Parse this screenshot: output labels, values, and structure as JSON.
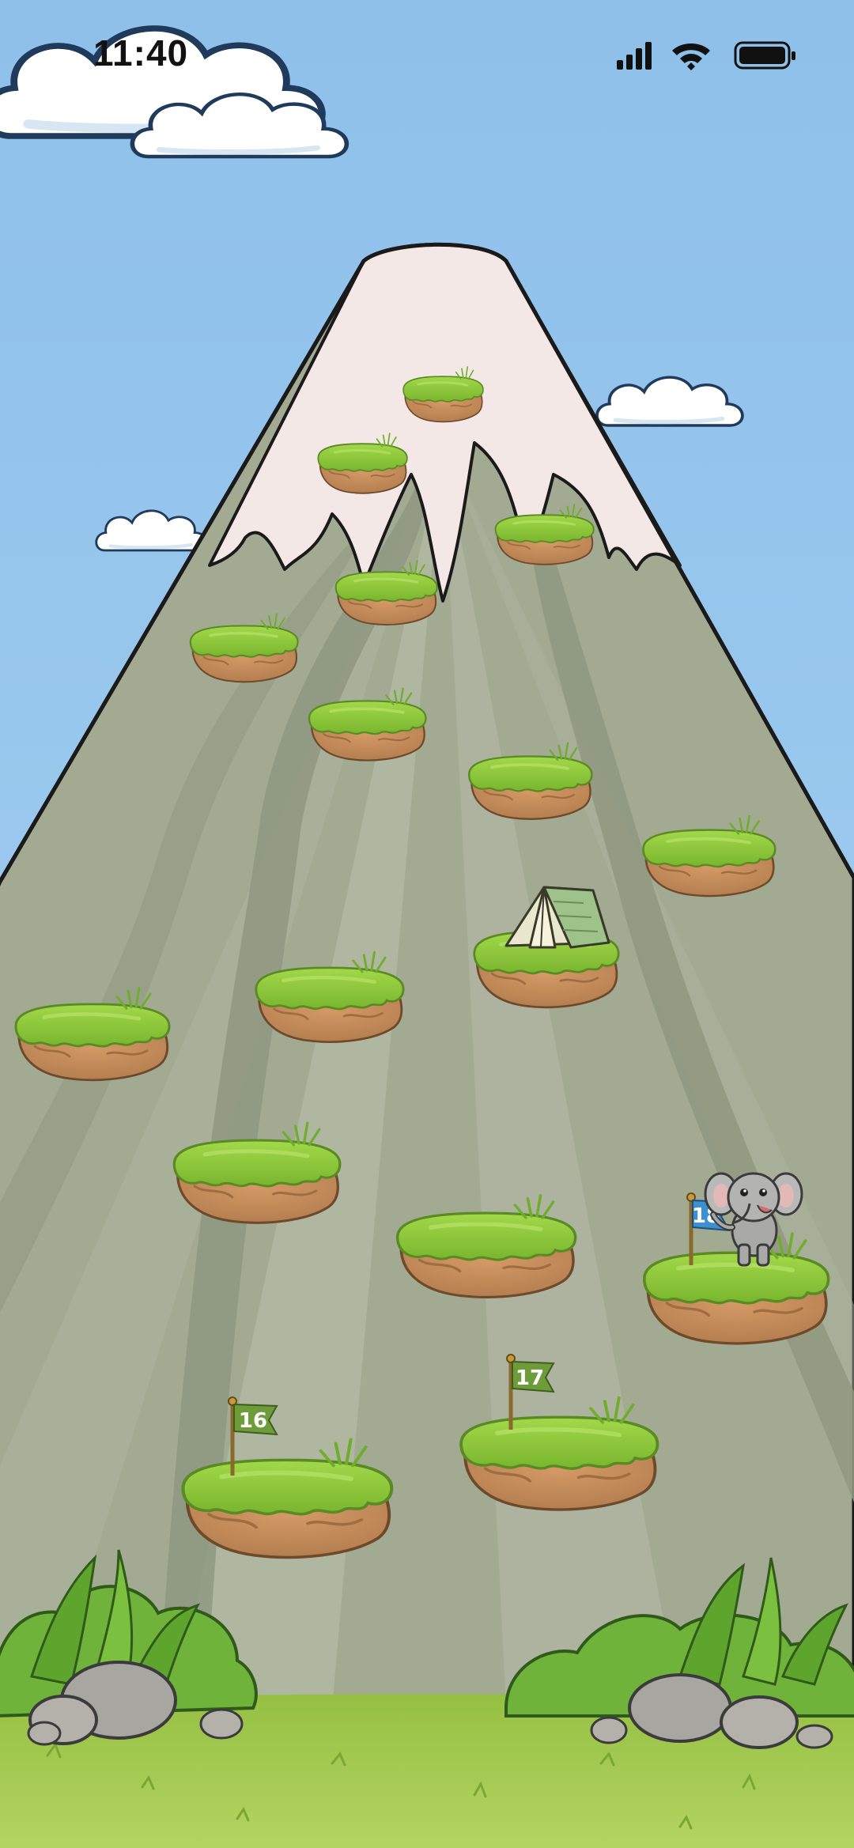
{
  "status_bar": {
    "time": "11:40",
    "icons": [
      "cellular-signal-icon",
      "wifi-icon",
      "battery-icon"
    ]
  },
  "level_map": {
    "flags": [
      {
        "label": "16",
        "state": "completed",
        "color": "#6f9c3a"
      },
      {
        "label": "17",
        "state": "completed",
        "color": "#6f9c3a"
      },
      {
        "label": "18",
        "state": "current",
        "color": "#3c8fd1"
      }
    ],
    "camp": {
      "icon": "tent-icon"
    },
    "player": {
      "icon": "elephant-icon"
    }
  },
  "colors": {
    "sky": "#8fc3ea",
    "mountain": "#9fa890",
    "snow": "#f4e8e6",
    "grass": "#8fcb3a",
    "dirt": "#c48d5c",
    "ground": "#a3c94c"
  }
}
